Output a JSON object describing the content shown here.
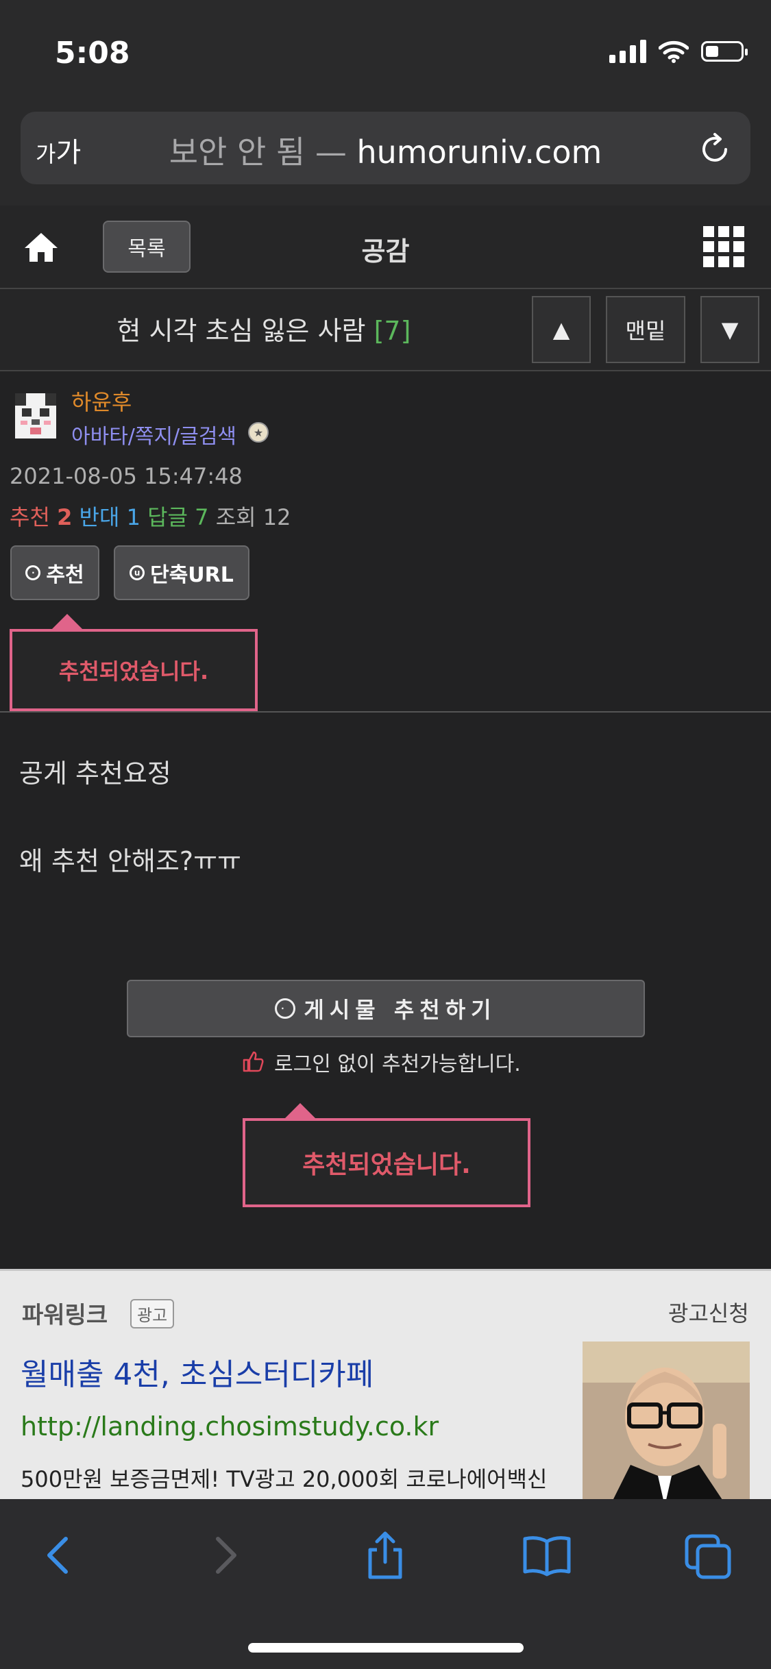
{
  "status_bar": {
    "time": "5:08"
  },
  "url_bar": {
    "aa_small": "가",
    "aa_large": "가",
    "insecure_label": "보안 안 됨 —",
    "domain": "humoruniv.com"
  },
  "board_nav": {
    "list_label": "목록",
    "board_title": "공감"
  },
  "post": {
    "title": "현 시각 초심 잃은 사람",
    "comment_count": "[7]",
    "nav": {
      "up": "▲",
      "bottom": "맨밑",
      "down": "▼"
    },
    "author": {
      "name": "하윤후",
      "links": "아바타/쪽지/글검색"
    },
    "date": "2021-08-05 15:47:48",
    "stats": {
      "rec_label": "추천",
      "rec_value": "2",
      "opp_label": "반대",
      "opp_value": "1",
      "reply_label": "답글",
      "reply_value": "7",
      "view_label": "조회",
      "view_value": "12"
    },
    "buttons": {
      "recommend": "추천",
      "short_url": "단축URL",
      "recommend_post": "게시물 추천하기"
    },
    "recommended_notice": "추천되었습니다.",
    "body_line1": "공게 추천요정",
    "body_line2": "왜 추천 안해조?ㅠㅠ",
    "no_login_note": "로그인 없이 추천가능합니다."
  },
  "ad": {
    "brand": "파워링크",
    "tag": "광고",
    "request": "광고신청",
    "headline": "월매출 4천, 초심스터디카페",
    "url": "http://landing.chosimstudy.co.kr",
    "description": "500만원 보증금면제! TV광고 20,000회 코로나에어백신"
  },
  "colors": {
    "accent_pink": "#e0648a",
    "link_blue": "#1a3ea8",
    "ad_green": "#2a7a1a",
    "toolbar_blue": "#3a8ee6"
  },
  "icons": [
    "home-icon",
    "grid-menu-icon",
    "reload-icon",
    "thumbs-up-icon",
    "back-icon",
    "forward-icon",
    "share-icon",
    "bookmarks-icon",
    "tabs-icon"
  ]
}
